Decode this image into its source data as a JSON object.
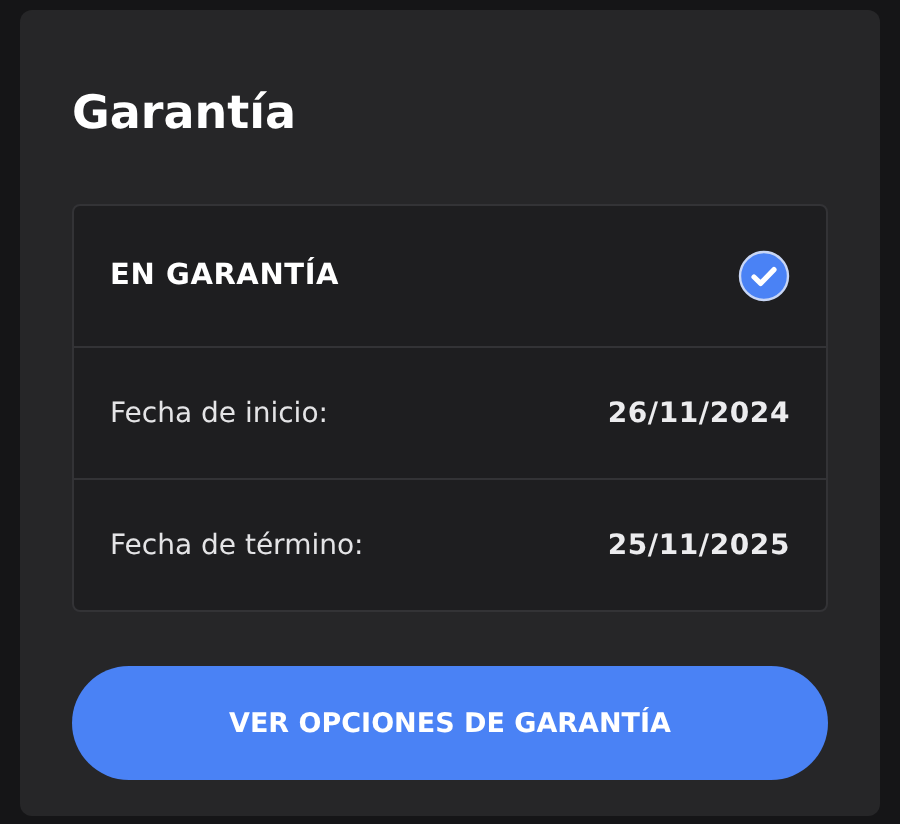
{
  "title": "Garantía",
  "status": {
    "label": "EN GARANTÍA",
    "checked": true
  },
  "dates": [
    {
      "label": "Fecha de inicio:",
      "value": "26/11/2024"
    },
    {
      "label": "Fecha de término:",
      "value": "25/11/2025"
    }
  ],
  "button": {
    "label": "VER OPCIONES DE GARANTÍA"
  }
}
